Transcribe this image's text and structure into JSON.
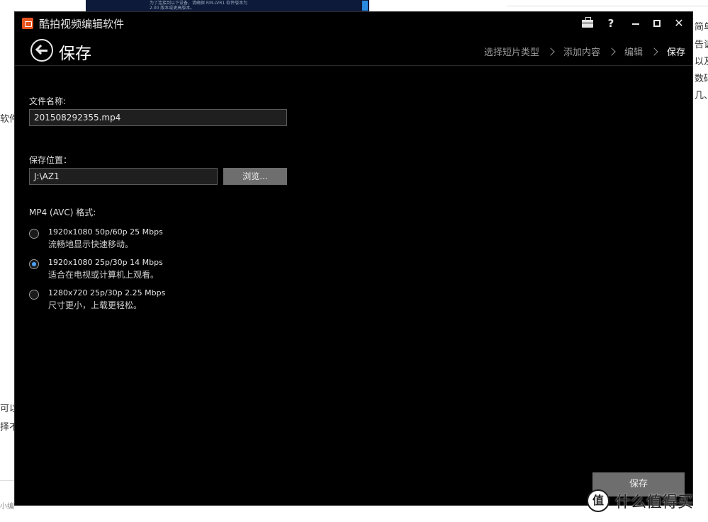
{
  "background": {
    "thumb_caption_1": "为了连接到以下设备，请确保 RM-LVR1 软件版本为",
    "thumb_caption_2": "2.00 版本或更高版本。",
    "left_fragments": [
      "软件",
      "可以",
      "择不",
      "小编说:"
    ],
    "right_fragments": [
      "简单来",
      "告诉大",
      "以及使",
      "数码设",
      "几、都"
    ]
  },
  "window": {
    "app_title": "酷拍视频编辑软件",
    "page_title": "保存",
    "title_buttons": {
      "toolbox_icon": "toolbox-icon",
      "help": "?",
      "close": "✕"
    },
    "breadcrumb": [
      "选择短片类型",
      "添加内容",
      "编辑",
      "保存"
    ],
    "active_step": 3
  },
  "form": {
    "filename_label": "文件名称:",
    "filename_value": "201508292355.mp4",
    "location_label": "保存位置：",
    "location_value": "J:\\AZ1",
    "browse_label": "浏览...",
    "format_label": "MP4 (AVC) 格式:",
    "options": [
      {
        "title": "1920x1080 50p/60p 25 Mbps",
        "desc": "流畅地显示快速移动。",
        "checked": false
      },
      {
        "title": "1920x1080 25p/30p 14 Mbps",
        "desc": "适合在电视或计算机上观看。",
        "checked": true
      },
      {
        "title": "1280x720 25p/30p 2.25 Mbps",
        "desc": "尺寸更小，上载更轻松。",
        "checked": false
      }
    ]
  },
  "footer": {
    "save_button": "保存"
  },
  "watermark": {
    "badge": "值",
    "text": "什么值得买"
  },
  "colors": {
    "window_bg": "#000000",
    "button_bg": "#6e6e6e",
    "radio_accent": "#4aa3ff",
    "app_icon": "#e8541e"
  }
}
